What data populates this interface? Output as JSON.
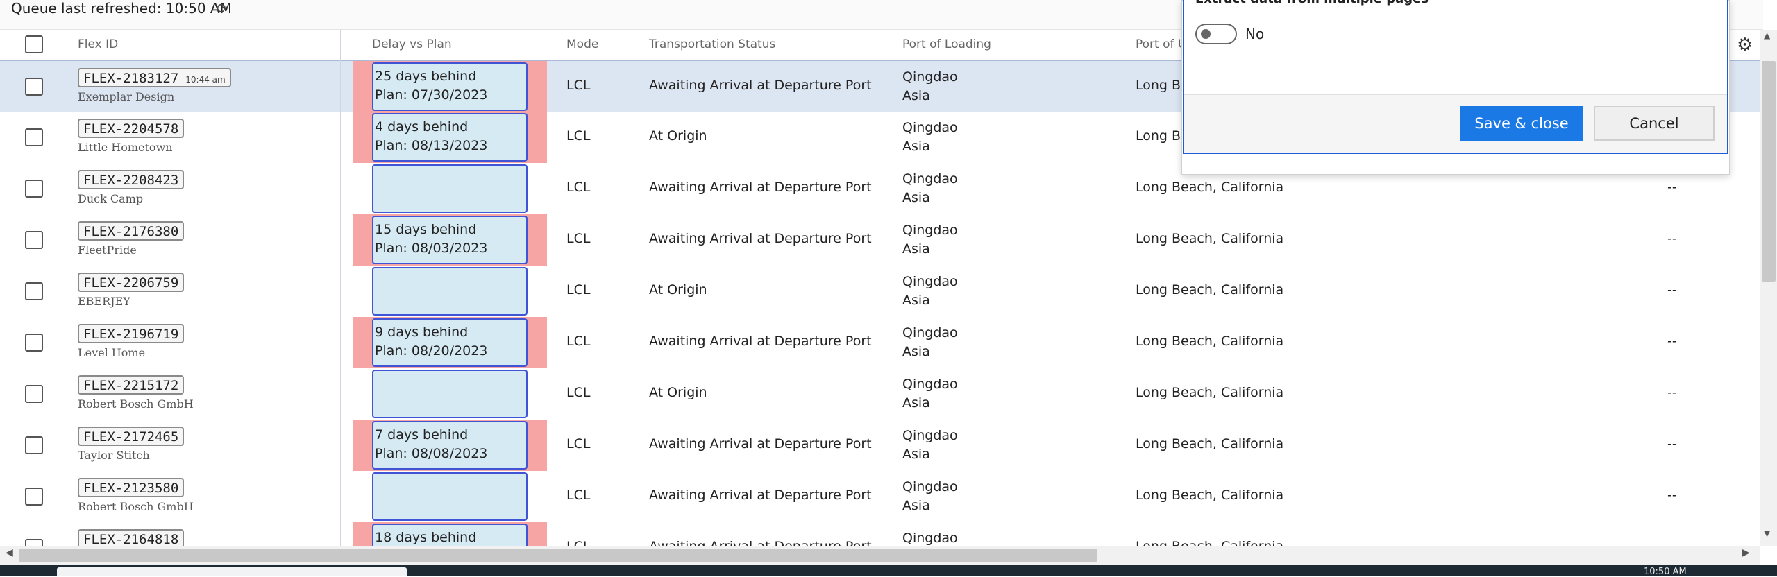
{
  "topbar": {
    "refresh_text": "Queue last refreshed: 10:50 AM",
    "refresh_icon": "⟳"
  },
  "columns": {
    "flex_id": "Flex ID",
    "delay": "Delay vs Plan",
    "mode": "Mode",
    "status": "Transportation Status",
    "port_loading": "Port of Loading",
    "port_unloading": "Port of U"
  },
  "rows": [
    {
      "id": "FLEX-2183127",
      "time": "10:44 am",
      "customer": "Exemplar Design",
      "delay_line1": "25 days behind",
      "delay_line2": "Plan: 07/30/2023",
      "delayed": true,
      "mode": "LCL",
      "status": "Awaiting Arrival at Departure Port",
      "pol_city": "Qingdao",
      "pol_region": "Asia",
      "pod": "Long Be",
      "last": "",
      "selected": true
    },
    {
      "id": "FLEX-2204578",
      "time": "",
      "customer": "Little Hometown",
      "delay_line1": "4 days behind",
      "delay_line2": "Plan: 08/13/2023",
      "delayed": true,
      "mode": "LCL",
      "status": "At Origin",
      "pol_city": "Qingdao",
      "pol_region": "Asia",
      "pod": "Long Be",
      "last": ""
    },
    {
      "id": "FLEX-2208423",
      "time": "",
      "customer": "Duck Camp",
      "delay_line1": "",
      "delay_line2": "",
      "delayed": false,
      "mode": "LCL",
      "status": "Awaiting Arrival at Departure Port",
      "pol_city": "Qingdao",
      "pol_region": "Asia",
      "pod": "Long Beach, California",
      "last": "--"
    },
    {
      "id": "FLEX-2176380",
      "time": "",
      "customer": "FleetPride",
      "delay_line1": "15 days behind",
      "delay_line2": "Plan: 08/03/2023",
      "delayed": true,
      "mode": "LCL",
      "status": "Awaiting Arrival at Departure Port",
      "pol_city": "Qingdao",
      "pol_region": "Asia",
      "pod": "Long Beach, California",
      "last": "--"
    },
    {
      "id": "FLEX-2206759",
      "time": "",
      "customer": "EBERJEY",
      "delay_line1": "",
      "delay_line2": "",
      "delayed": false,
      "mode": "LCL",
      "status": "At Origin",
      "pol_city": "Qingdao",
      "pol_region": "Asia",
      "pod": "Long Beach, California",
      "last": "--"
    },
    {
      "id": "FLEX-2196719",
      "time": "",
      "customer": "Level Home",
      "delay_line1": "9 days behind",
      "delay_line2": "Plan: 08/20/2023",
      "delayed": true,
      "mode": "LCL",
      "status": "Awaiting Arrival at Departure Port",
      "pol_city": "Qingdao",
      "pol_region": "Asia",
      "pod": "Long Beach, California",
      "last": "--"
    },
    {
      "id": "FLEX-2215172",
      "time": "",
      "customer": "Robert Bosch GmbH",
      "delay_line1": "",
      "delay_line2": "",
      "delayed": false,
      "mode": "LCL",
      "status": "At Origin",
      "pol_city": "Qingdao",
      "pol_region": "Asia",
      "pod": "Long Beach, California",
      "last": "--"
    },
    {
      "id": "FLEX-2172465",
      "time": "",
      "customer": "Taylor Stitch",
      "delay_line1": "7 days behind",
      "delay_line2": "Plan: 08/08/2023",
      "delayed": true,
      "mode": "LCL",
      "status": "Awaiting Arrival at Departure Port",
      "pol_city": "Qingdao",
      "pol_region": "Asia",
      "pod": "Long Beach, California",
      "last": "--"
    },
    {
      "id": "FLEX-2123580",
      "time": "",
      "customer": "Robert Bosch GmbH",
      "delay_line1": "",
      "delay_line2": "",
      "delayed": false,
      "mode": "LCL",
      "status": "Awaiting Arrival at Departure Port",
      "pol_city": "Qingdao",
      "pol_region": "Asia",
      "pod": "Long Beach, California",
      "last": "--"
    },
    {
      "id": "FLEX-2164818",
      "time": "",
      "customer": "",
      "delay_line1": "18 days behind",
      "delay_line2": "",
      "delayed": true,
      "mode": "LCL",
      "status": "Awaiting Arrival at Departure Port",
      "pol_city": "Qingdao",
      "pol_region": "",
      "pod": "Long Beach, California",
      "last": ""
    }
  ],
  "modal": {
    "title": "Extract data from multiple pages",
    "toggle_label": "No",
    "save_label": "Save & close",
    "cancel_label": "Cancel"
  },
  "icons": {
    "gear": "⚙",
    "up": "▲",
    "down": "▼",
    "left": "◀",
    "right": "▶"
  },
  "colors": {
    "delay_red": "#f7a4a4",
    "delay_box": "#d6eaf3",
    "delay_border": "#3f55d6",
    "primary": "#1b79e6",
    "selected_row": "#dce5f2"
  },
  "taskbar": {
    "clock": "10:50 AM"
  }
}
